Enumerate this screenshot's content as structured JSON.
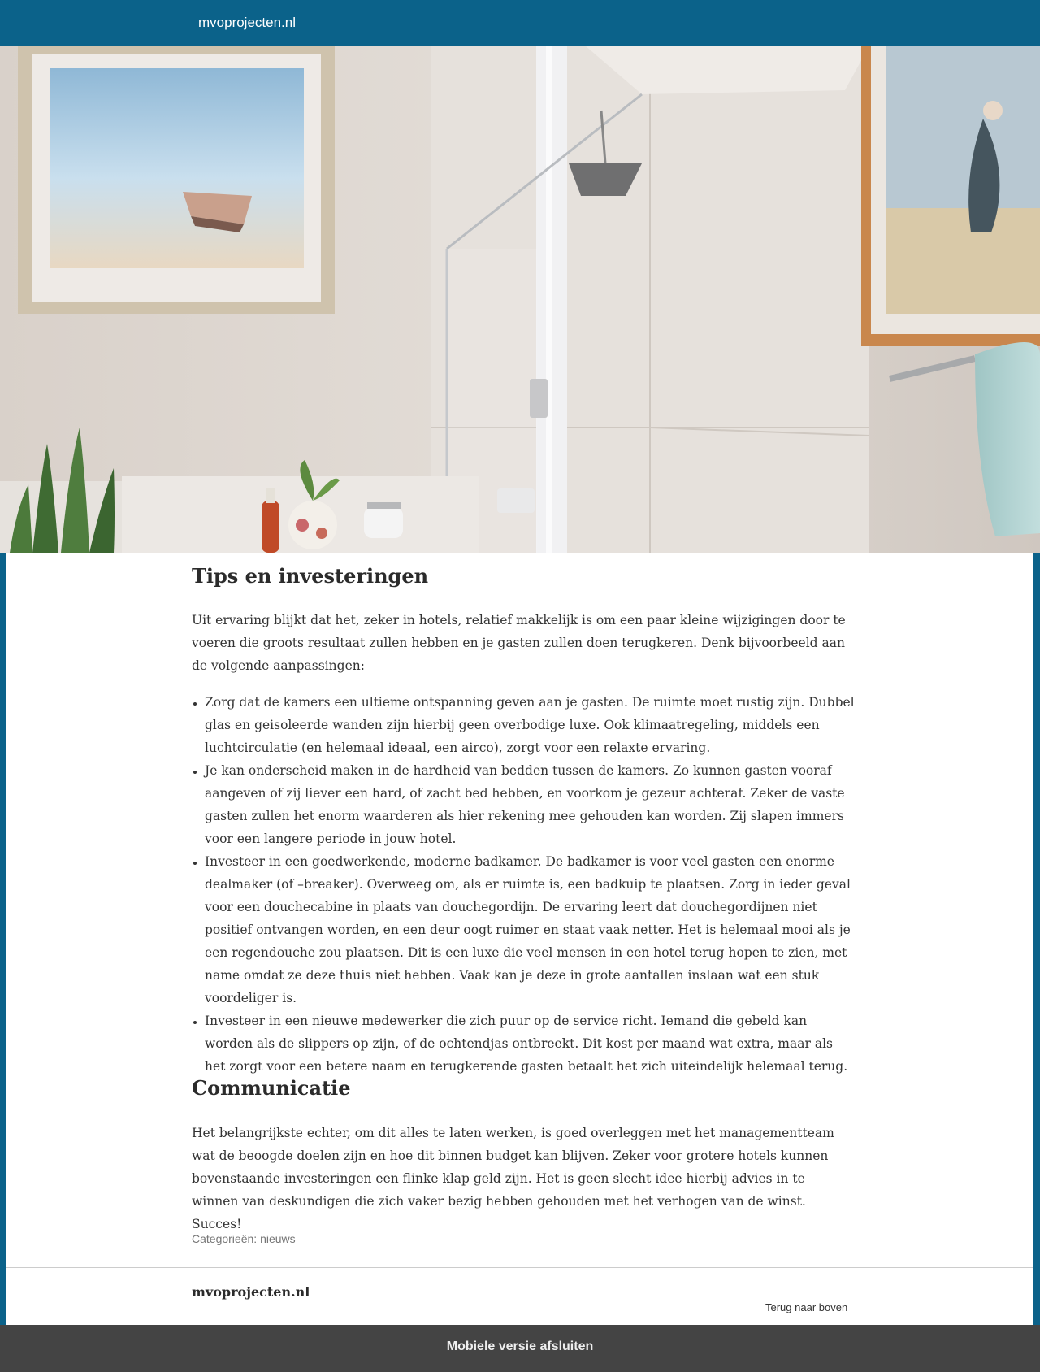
{
  "header": {
    "site_title": "mvoprojecten.nl"
  },
  "hero": {
    "image_description_icon": "bathroom-photo"
  },
  "article": {
    "heading_tips": "Tips en investeringen",
    "intro": "Uit ervaring blijkt dat het, zeker in hotels, relatief makkelijk is om een paar kleine wijzigingen door te voeren die groots resultaat zullen hebben en je gasten zullen doen terugkeren. Denk bijvoorbeeld aan de volgende aanpassingen:",
    "tips": [
      "Zorg dat de kamers een ultieme ontspanning geven aan je gasten. De ruimte moet rustig zijn. Dubbel glas en geisoleerde wanden zijn hierbij geen overbodige luxe. Ook klimaatregeling, middels een luchtcirculatie (en helemaal ideaal, een airco), zorgt voor een relaxte ervaring.",
      "Je kan onderscheid maken in de hardheid van bedden tussen de kamers. Zo kunnen gasten vooraf aangeven of zij liever een hard, of zacht bed hebben, en voorkom je gezeur achteraf. Zeker de vaste gasten zullen het enorm waarderen als hier rekening mee gehouden kan worden. Zij slapen immers voor een langere periode in jouw hotel.",
      "Investeer in een goedwerkende, moderne badkamer. De badkamer is voor veel gasten een enorme dealmaker (of –breaker). Overweeg om, als er ruimte is, een badkuip te plaatsen. Zorg in ieder geval voor een douchecabine in plaats van douchegordijn. De ervaring leert dat douchegordijnen niet positief ontvangen worden, en een deur oogt ruimer en staat vaak netter. Het is helemaal mooi als je een regendouche zou plaatsen. Dit is een luxe die veel mensen in een hotel terug hopen te zien, met name omdat ze deze thuis niet hebben. Vaak kan je deze in grote aantallen inslaan wat een stuk voordeliger is.",
      "Investeer in een nieuwe medewerker die zich puur op de service richt. Iemand die gebeld kan worden als de slippers op zijn, of de ochtendjas ontbreekt. Dit kost per maand wat extra, maar als het zorgt voor een betere naam en terugkerende gasten betaalt het zich uiteindelijk helemaal terug."
    ],
    "heading_comm": "Communicatie",
    "comm": "Het belangrijkste echter, om dit alles te laten werken, is goed overleggen met het managementteam wat de beoogde doelen zijn en hoe dit binnen budget kan blijven. Zeker voor grotere hotels kunnen bovenstaande investeringen een flinke klap geld zijn. Het is geen slecht idee hierbij advies in te winnen van deskundigen die zich vaker bezig hebben gehouden met het verhogen van de winst. Succes!",
    "categories_label": "Categorieën:",
    "category": "nieuws"
  },
  "footer": {
    "site_title": "mvoprojecten.nl",
    "back_to_top": "Terug naar boven"
  },
  "mobile_bar": {
    "label": "Mobiele versie afsluiten"
  },
  "colors": {
    "brand": "#0b628a",
    "mobile_bar": "#444444"
  }
}
